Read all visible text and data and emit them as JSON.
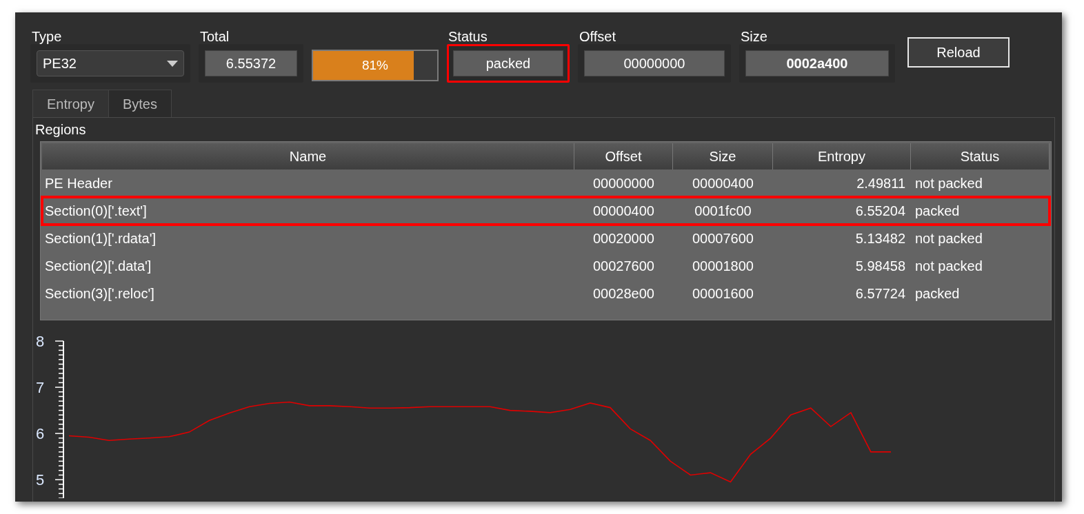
{
  "fields": [
    {
      "kind": "combo",
      "label": "Type",
      "value": "PE32",
      "annotated": false
    },
    {
      "kind": "text",
      "label": "Total",
      "value": "6.55372",
      "annotated": false
    },
    {
      "kind": "progress",
      "text": "81%",
      "level": 0.81
    },
    {
      "kind": "text",
      "label": "Status",
      "value": "packed",
      "annotated": true
    },
    {
      "kind": "text",
      "label": "Offset",
      "value": "00000000",
      "annotated": false
    },
    {
      "kind": "bold",
      "label": "Size",
      "value": "0002a400",
      "annotated": false
    }
  ],
  "reload_button": "Reload",
  "tabs": [
    {
      "label": "Entropy",
      "selected": true
    },
    {
      "label": "Bytes",
      "selected": false
    }
  ],
  "regions": {
    "title": "Regions",
    "columns": [
      "Name",
      "Offset",
      "Size",
      "Entropy",
      "Status"
    ],
    "rows": [
      {
        "cells": [
          "PE Header",
          "00000000",
          "00000400",
          "2.49811",
          "not packed"
        ],
        "annotated": false
      },
      {
        "cells": [
          "Section(0)['.text']",
          "00000400",
          "0001fc00",
          "6.55204",
          "packed"
        ],
        "annotated": true
      },
      {
        "cells": [
          "Section(1)['.rdata']",
          "00020000",
          "00007600",
          "5.13482",
          "not packed"
        ],
        "annotated": false
      },
      {
        "cells": [
          "Section(2)['.data']",
          "00027600",
          "00001800",
          "5.98458",
          "not packed"
        ],
        "annotated": false
      },
      {
        "cells": [
          "Section(3)['.reloc']",
          "00028e00",
          "00001600",
          "6.57724",
          "packed"
        ],
        "annotated": false
      }
    ]
  },
  "chart_data": {
    "type": "line",
    "ylim": [
      4.6,
      8
    ],
    "yticks": [
      5,
      6,
      7,
      8
    ],
    "series": [
      {
        "color": "#e00000",
        "values": [
          5.95,
          5.92,
          5.85,
          5.88,
          5.9,
          5.93,
          6.03,
          6.28,
          6.44,
          6.58,
          6.65,
          6.68,
          6.6,
          6.6,
          6.58,
          6.55,
          6.55,
          6.56,
          6.58,
          6.58,
          6.58,
          6.58,
          6.5,
          6.48,
          6.45,
          6.52,
          6.66,
          6.56,
          6.1,
          5.85,
          5.4,
          5.1,
          5.15,
          4.95,
          5.55,
          5.9,
          6.4,
          6.55,
          6.15,
          6.45,
          5.6,
          5.6
        ]
      }
    ]
  }
}
